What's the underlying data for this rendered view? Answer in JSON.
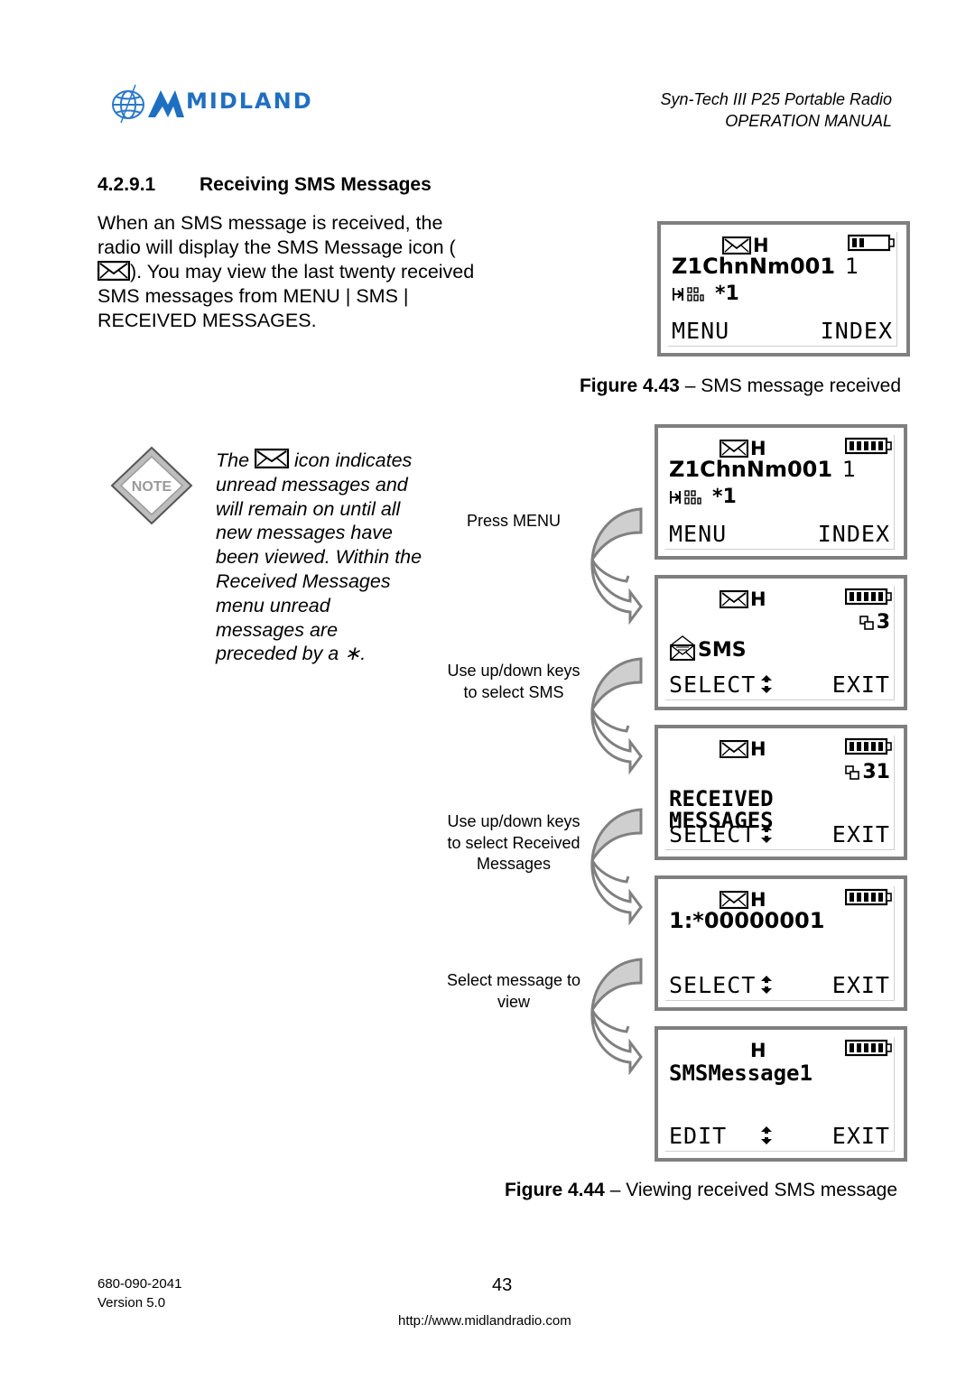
{
  "header": {
    "brand": "MIDLAND",
    "doc_title": "Syn-Tech III P25 Portable Radio",
    "doc_subtitle": "OPERATION MANUAL"
  },
  "section": {
    "number": "4.2.9.1",
    "title": "Receiving SMS Messages"
  },
  "intro": {
    "part1": "When an SMS message is received, the radio will display the SMS Message icon (",
    "icon": "envelope-icon",
    "part2": "). You may view the last twenty received SMS messages from MENU | SMS | RECEIVED MESSAGES."
  },
  "figure43": {
    "label": "Figure 4.43",
    "dash": " – ",
    "text": "SMS message received",
    "screen": {
      "mode": "H",
      "battery_level": 0.4,
      "channel_name": "Z1ChnNm001",
      "channel_number": "1",
      "zone": "*1",
      "soft_left": "MENU",
      "soft_right": "INDEX"
    }
  },
  "note": {
    "badge": "NOTE",
    "text_pre": "The",
    "text_post": "icon indicates unread messages and will remain on until all new messages have been viewed. Within the Received Messages menu unread messages are preceded by a ∗."
  },
  "figure44": {
    "label": "Figure 4.44",
    "dash": " – ",
    "text": "Viewing received SMS message",
    "steps": [
      {
        "label": "Press MENU"
      },
      {
        "label": "Use up/down keys to select SMS"
      },
      {
        "label": "Use up/down keys to select Received Messages"
      },
      {
        "label": "Select message to view"
      }
    ],
    "screens": [
      {
        "mode": "H",
        "battery_level": 1.0,
        "channel_name": "Z1ChnNm001",
        "channel_number": "1",
        "zone": "*1",
        "soft_left": "MENU",
        "soft_right": "INDEX"
      },
      {
        "mode": "H",
        "battery_level": 1.0,
        "counter": "3",
        "menu_item": "SMS",
        "soft_left": "SELECT",
        "soft_right": "EXIT"
      },
      {
        "mode": "H",
        "battery_level": 1.0,
        "counter": "31",
        "menu_line1": "RECEIVED",
        "menu_line2": "MESSAGES",
        "soft_left": "SELECT",
        "soft_right": "EXIT"
      },
      {
        "mode": "H",
        "battery_level": 1.0,
        "message_entry": "1:*00000001",
        "soft_left": "SELECT",
        "soft_right": "EXIT"
      },
      {
        "mode": "H",
        "battery_level": 1.0,
        "message_text": "SMSMessage1",
        "soft_left": "EDIT",
        "soft_right": "EXIT"
      }
    ]
  },
  "footer": {
    "part_number": "680-090-2041",
    "version": "Version 5.0",
    "page": "43",
    "url": "http://www.midlandradio.com"
  }
}
